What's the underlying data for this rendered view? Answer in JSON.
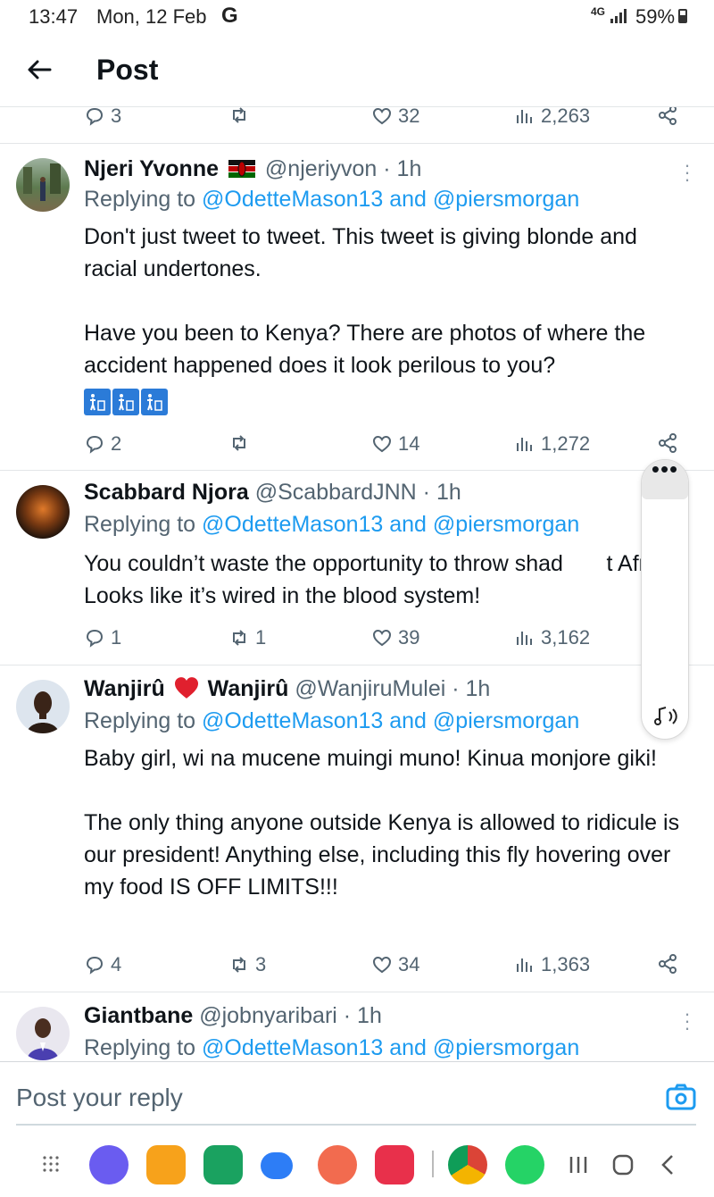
{
  "status_bar": {
    "time": "13:47",
    "date": "Mon, 12 Feb",
    "google": "G",
    "network": "4G",
    "battery": "59%"
  },
  "header": {
    "title": "Post"
  },
  "top_actions": {
    "replies": "3",
    "reposts": "",
    "likes": "32",
    "views": "2,263"
  },
  "tweets": [
    {
      "name": "Njeri Yvonne",
      "handle": "@njeriyvon · 1h",
      "reply_prefix": "Replying to",
      "reply_mentions": "@OdetteMason13 and @piersmorgan",
      "text": "Don't just tweet to tweet. This tweet is giving blonde and racial undertones.\n\nHave you been to Kenya? There are photos of where the accident happened does it look perilous to you?",
      "actions": {
        "replies": "2",
        "reposts": "",
        "likes": "14",
        "views": "1,272"
      }
    },
    {
      "name": "Scabbard Njora",
      "handle": "@ScabbardJNN · 1h",
      "reply_prefix": "Replying to",
      "reply_mentions": "@OdetteMason13 and @piersmorgan",
      "text": "You couldn’t waste the opportunity to throw shad       t Africa. Looks like it’s wired in the blood system!",
      "actions": {
        "replies": "1",
        "reposts": "1",
        "likes": "39",
        "views": "3,162"
      }
    },
    {
      "name_a": "Wanjirû",
      "name_b": "Wanjirû",
      "handle": "@WanjiruMulei · 1h",
      "reply_prefix": "Replying to",
      "reply_mentions": "@OdetteMason13 and @piersmorgan",
      "text": "Baby girl, wi na mucene muingi muno! Kinua monjore giki!\n\nThe only thing anyone outside Kenya is allowed to ridicule is our president! Anything else, including this fly hovering over my food IS OFF LIMITS!!!",
      "actions": {
        "replies": "4",
        "reposts": "3",
        "likes": "34",
        "views": "1,363"
      }
    },
    {
      "name": "Giantbane",
      "handle": "@jobnyaribari · 1h",
      "reply_prefix": "Replying to",
      "reply_mentions": "@OdetteMason13 and @piersmorgan"
    }
  ],
  "reply_bar": {
    "placeholder": "Post your reply"
  },
  "colors": {
    "accent": "#1d9bf0",
    "text": "#0f1419",
    "muted": "#536471"
  },
  "icons": [
    "back-arrow-icon",
    "reply-icon",
    "repost-icon",
    "like-icon",
    "views-icon",
    "share-icon",
    "more-icon",
    "camera-icon",
    "trash-emoji-icon",
    "heart-emoji-icon",
    "kenya-flag-icon"
  ]
}
